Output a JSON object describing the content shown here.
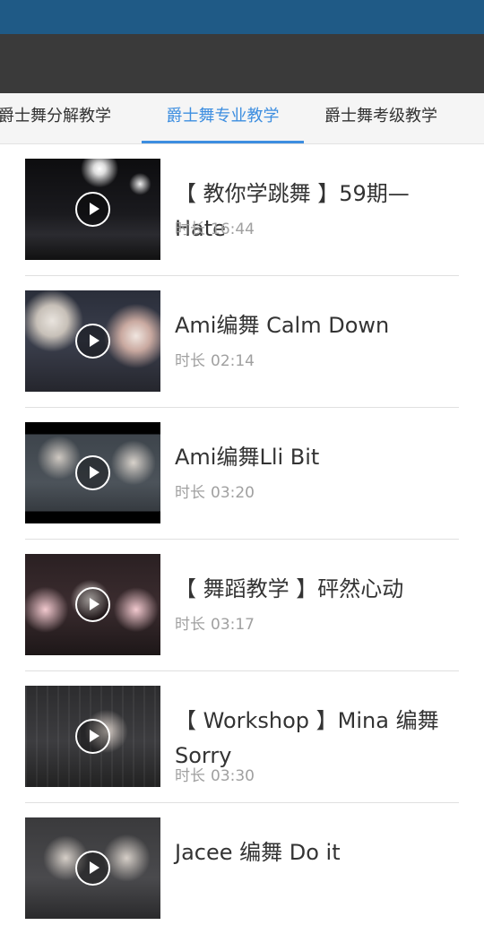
{
  "tabs": [
    {
      "label": "爵士舞分解教学",
      "active": false
    },
    {
      "label": "爵士舞专业教学",
      "active": true
    },
    {
      "label": "爵士舞考级教学",
      "active": false
    }
  ],
  "colors": {
    "status_bar": "#1f5a86",
    "title_bar": "#3a3a3a",
    "accent": "#3d8ee0"
  },
  "videos": [
    {
      "title": "【 教你学跳舞 】59期—Hate",
      "duration_label": "时长",
      "duration": "16:44"
    },
    {
      "title": "Ami编舞 Calm Down",
      "duration_label": "时长",
      "duration": "02:14"
    },
    {
      "title": "Ami编舞Lli Bit",
      "duration_label": "时长",
      "duration": "03:20"
    },
    {
      "title": "【 舞蹈教学 】砰然心动",
      "duration_label": "时长",
      "duration": "03:17"
    },
    {
      "title": "【 Workshop 】Mina 编舞 Sorry",
      "duration_label": "时长",
      "duration": "03:30"
    },
    {
      "title": "Jacee 编舞 Do it",
      "duration_label": "",
      "duration": ""
    }
  ],
  "icons": {
    "play": "play-circle-icon"
  }
}
